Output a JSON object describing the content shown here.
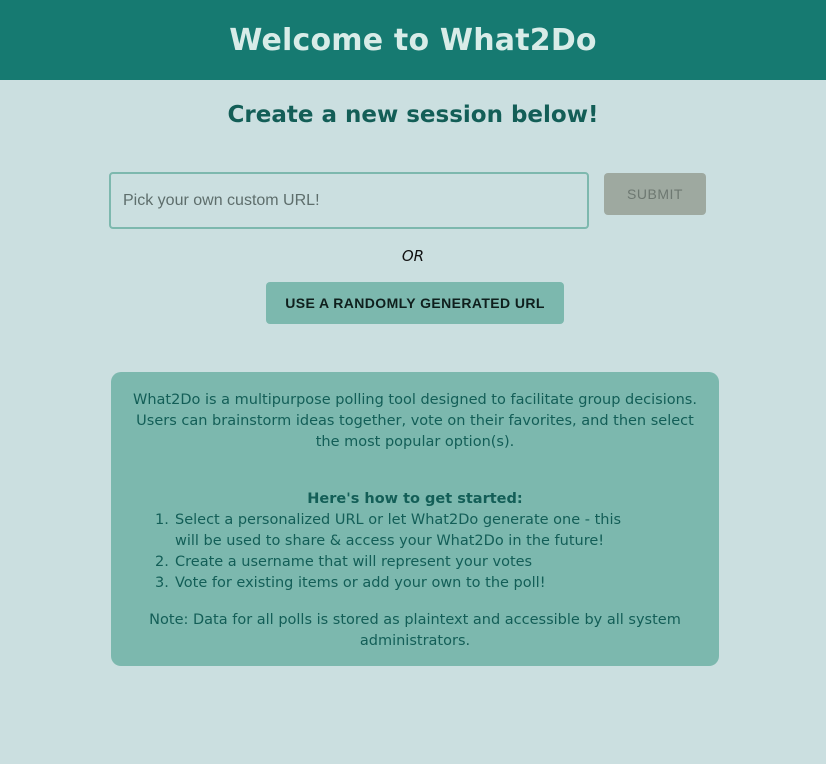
{
  "header": {
    "title": "Welcome to What2Do"
  },
  "main": {
    "subtitle": "Create a new session below!",
    "url_input": {
      "value": "",
      "placeholder": "Pick your own custom URL!"
    },
    "submit_label": "SUBMIT",
    "or_label": "OR",
    "random_button_label": "USE A RANDOMLY GENERATED URL"
  },
  "info": {
    "intro": "What2Do is a multipurpose polling tool designed to facilitate group decisions. Users can brainstorm ideas together, vote on their favorites, and then select the most popular option(s).",
    "steps_title": "Here's how to get started:",
    "steps": [
      {
        "num": "1.",
        "text": "Select a personalized URL or let What2Do generate one - this will be used to share & access your What2Do in the future!"
      },
      {
        "num": "2.",
        "text": "Create a username that will represent your votes"
      },
      {
        "num": "3.",
        "text": "Vote for existing items or add your own to the poll!"
      }
    ],
    "note": "Note: Data for all polls is stored as plaintext and accessible by all system administrators."
  },
  "colors": {
    "header_bg": "#167a71",
    "page_bg": "#cbdfe0",
    "accent": "#7cb8ae",
    "text_dark_teal": "#135e57",
    "submit_disabled_bg": "#9ea9a0"
  }
}
